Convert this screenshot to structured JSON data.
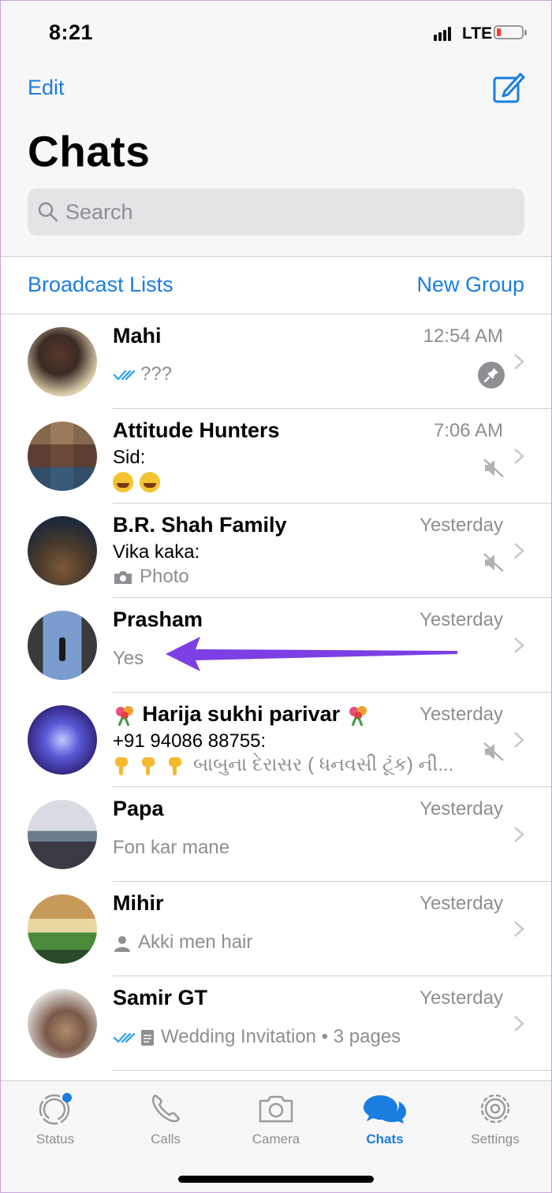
{
  "status_bar": {
    "time": "8:21",
    "network": "LTE"
  },
  "header": {
    "edit_label": "Edit",
    "title": "Chats",
    "search_placeholder": "Search"
  },
  "lists": {
    "broadcast_label": "Broadcast Lists",
    "new_group_label": "New Group"
  },
  "chats": [
    {
      "name": "Mahi",
      "time": "12:54 AM",
      "preview": "???",
      "read_ticks": true,
      "pinned": true
    },
    {
      "name": "Attitude Hunters",
      "time": "7:06 AM",
      "sender": "Sid:",
      "muted": true,
      "preview_emojis": "two laughing-with-tears emojis"
    },
    {
      "name": "B.R. Shah Family",
      "time": "Yesterday",
      "sender": "Vika kaka:",
      "preview": "Photo",
      "muted": true
    },
    {
      "name": "Prasham",
      "time": "Yesterday",
      "preview": "Yes"
    },
    {
      "name": "Harija sukhi parivar",
      "time": "Yesterday",
      "sender": "+91 94086 88755:",
      "preview": "બાબુના દેરાસર ( ધનવસી ટૂંક) ની...",
      "muted": true
    },
    {
      "name": "Papa",
      "time": "Yesterday",
      "preview": "Fon kar mane"
    },
    {
      "name": "Mihir",
      "time": "Yesterday",
      "preview": "Akki men hair"
    },
    {
      "name": "Samir GT",
      "time": "Yesterday",
      "preview": "Wedding Invitation • 3 pages",
      "read_ticks": true
    }
  ],
  "tabbar": {
    "tabs": [
      {
        "label": "Status"
      },
      {
        "label": "Calls"
      },
      {
        "label": "Camera"
      },
      {
        "label": "Chats",
        "active": true
      },
      {
        "label": "Settings"
      }
    ]
  },
  "colors": {
    "accent": "#1a7ee0",
    "arrow": "#7b3fe4",
    "muted_text": "#8e8e93"
  }
}
